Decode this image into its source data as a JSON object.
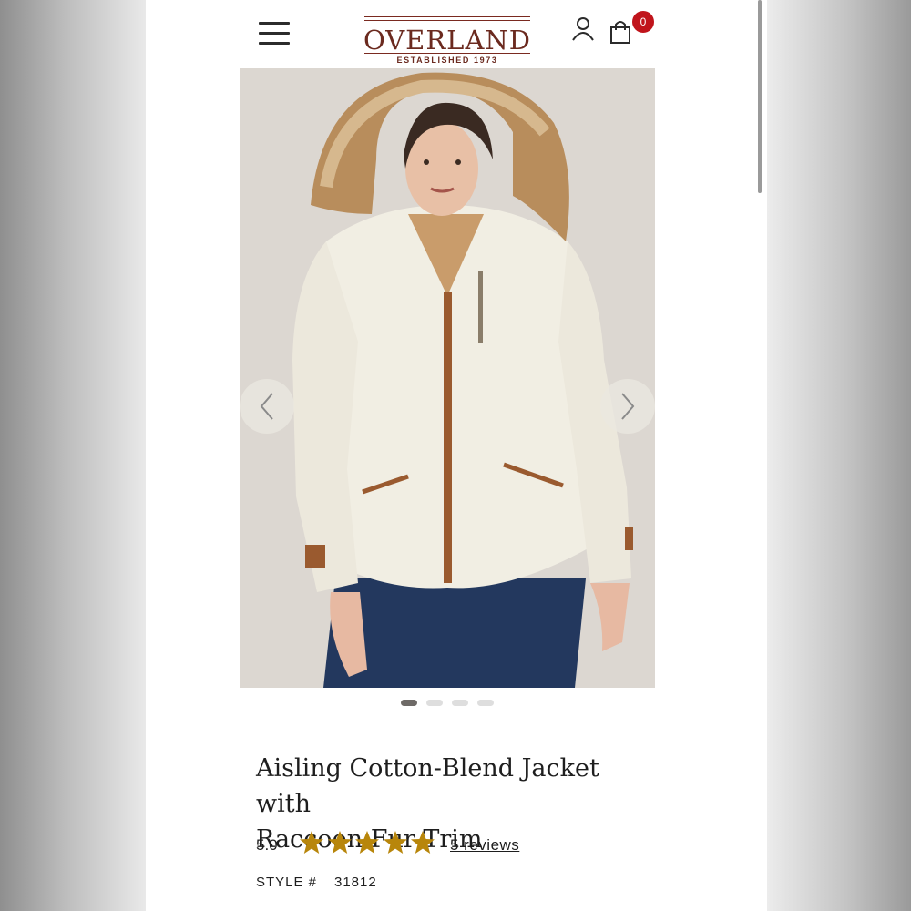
{
  "header": {
    "brand_name": "OVERLAND",
    "brand_tagline": "ESTABLISHED 1973",
    "cart_count": "0",
    "icons": [
      "menu-icon",
      "account-icon",
      "shopping-bag-icon"
    ]
  },
  "gallery": {
    "image_count": 4,
    "active_index": 0,
    "icons": [
      "chevron-left-icon",
      "chevron-right-icon"
    ]
  },
  "product": {
    "title_line1": "Aisling Cotton-Blend Jacket with",
    "title_line2": "Raccoon Fur Trim",
    "rating": "5.0",
    "stars_filled": 5,
    "stars_total": 5,
    "reviews_link": "5 reviews",
    "style_label": "STYLE #",
    "style_number": "31812"
  },
  "colors": {
    "brand": "#6b2a1f",
    "badge": "#c0141b",
    "star": "#b8860b",
    "text": "#1e1e1e"
  }
}
